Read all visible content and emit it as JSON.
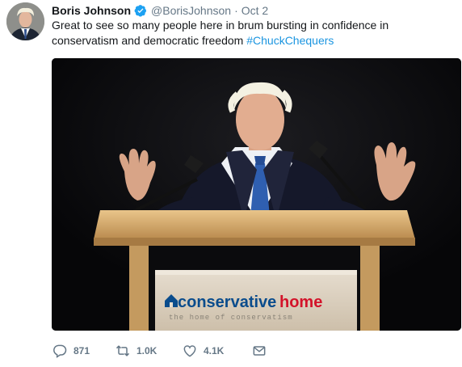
{
  "tweet": {
    "author_name": "Boris Johnson",
    "handle": "@BorisJohnson",
    "separator": "·",
    "date": "Oct 2",
    "text_main": "Great to see so many people here in brum bursting in confidence in conservatism and democratic freedom ",
    "hashtag": "#ChuckChequers",
    "verified": true
  },
  "media": {
    "podium_brand_prefix": "conservative",
    "podium_brand_suffix": "home",
    "podium_tagline": "the home of conservatism"
  },
  "actions": {
    "reply_count": "871",
    "retweet_count": "1.0K",
    "like_count": "4.1K"
  },
  "colors": {
    "link": "#1b95e0",
    "secondary_text": "#657786",
    "verified_badge": "#1da1f2",
    "brand_blue": "#0a4c8c",
    "brand_red": "#d3132a"
  }
}
